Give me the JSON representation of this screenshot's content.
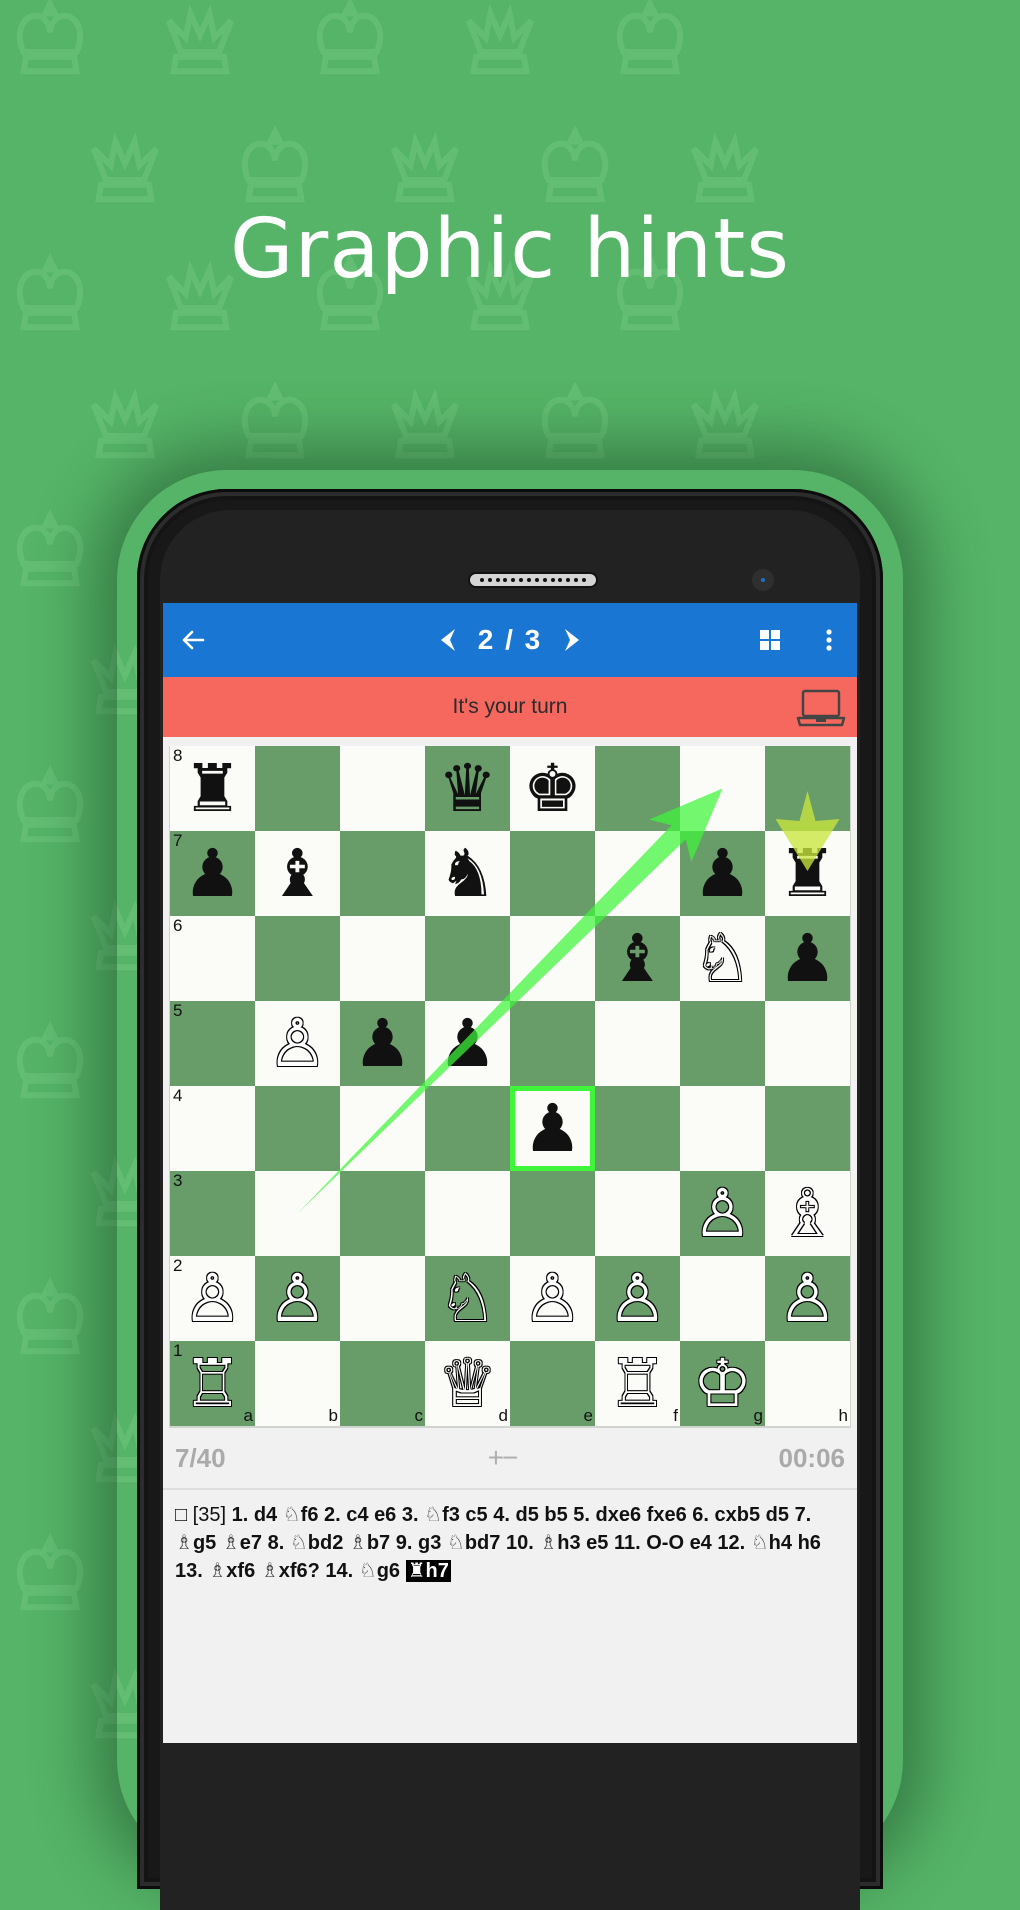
{
  "hero": {
    "title": "Graphic hints"
  },
  "colors": {
    "background": "#55b467",
    "pattern": "#63be73",
    "appbar": "#1976d2",
    "turnbar": "#f6675e",
    "light_square": "#fbfcf8",
    "dark_square": "#689d6a",
    "hint_arrow": "#3ef53a",
    "target_arrow": "#c8e63c",
    "highlight": "#3ef53a"
  },
  "appbar": {
    "back_icon": "arrow-left",
    "prev_icon": "chevron-left",
    "counter": "2 / 3",
    "next_icon": "chevron-right",
    "grid_icon": "grid-view",
    "menu_icon": "more-vertical"
  },
  "turnbar": {
    "message": "It's your turn",
    "opponent_icon": "laptop"
  },
  "board": {
    "files": [
      "a",
      "b",
      "c",
      "d",
      "e",
      "f",
      "g",
      "h"
    ],
    "ranks": [
      "8",
      "7",
      "6",
      "5",
      "4",
      "3",
      "2",
      "1"
    ],
    "pieces": [
      {
        "square": "a8",
        "color": "b",
        "type": "R"
      },
      {
        "square": "d8",
        "color": "b",
        "type": "Q"
      },
      {
        "square": "e8",
        "color": "b",
        "type": "K"
      },
      {
        "square": "a7",
        "color": "b",
        "type": "P"
      },
      {
        "square": "b7",
        "color": "b",
        "type": "B"
      },
      {
        "square": "d7",
        "color": "b",
        "type": "N"
      },
      {
        "square": "g7",
        "color": "b",
        "type": "P"
      },
      {
        "square": "h7",
        "color": "b",
        "type": "R"
      },
      {
        "square": "f6",
        "color": "b",
        "type": "B"
      },
      {
        "square": "g6",
        "color": "w",
        "type": "N"
      },
      {
        "square": "h6",
        "color": "b",
        "type": "P"
      },
      {
        "square": "b5",
        "color": "w",
        "type": "P"
      },
      {
        "square": "c5",
        "color": "b",
        "type": "P"
      },
      {
        "square": "d5",
        "color": "b",
        "type": "P"
      },
      {
        "square": "e4",
        "color": "b",
        "type": "P"
      },
      {
        "square": "g3",
        "color": "w",
        "type": "P"
      },
      {
        "square": "h3",
        "color": "w",
        "type": "B"
      },
      {
        "square": "a2",
        "color": "w",
        "type": "P"
      },
      {
        "square": "b2",
        "color": "w",
        "type": "P"
      },
      {
        "square": "d2",
        "color": "w",
        "type": "N"
      },
      {
        "square": "e2",
        "color": "w",
        "type": "P"
      },
      {
        "square": "f2",
        "color": "w",
        "type": "P"
      },
      {
        "square": "h2",
        "color": "w",
        "type": "P"
      },
      {
        "square": "a1",
        "color": "w",
        "type": "R"
      },
      {
        "square": "d1",
        "color": "w",
        "type": "Q"
      },
      {
        "square": "f1",
        "color": "w",
        "type": "R"
      },
      {
        "square": "g1",
        "color": "w",
        "type": "K"
      }
    ],
    "highlighted_square": "e4",
    "hint_arrow": {
      "from": "b3",
      "to": "g8"
    },
    "target_marker": {
      "from": "h8",
      "to": "h7"
    }
  },
  "status": {
    "progress": "7/40",
    "evaluation": "+−",
    "timer": "00:06"
  },
  "moves": {
    "prefix": "□",
    "game_number": "[35]",
    "tokens": [
      "1. d4",
      "♘f6",
      "2. c4",
      "e6",
      "3. ♘f3",
      "c5",
      "4. d5",
      "b5",
      "5. dxe6",
      "fxe6",
      "6. cxb5",
      "d5",
      "7. ♗g5",
      "♗e7",
      "8. ♘bd2",
      "♗b7",
      "9. g3",
      "♘bd7",
      "10. ♗h3",
      "e5",
      "11. O-O",
      "e4",
      "12. ♘h4",
      "h6",
      "13. ♗xf6",
      "♗xf6?",
      "14. ♘g6"
    ],
    "current_move": "♜h7"
  }
}
